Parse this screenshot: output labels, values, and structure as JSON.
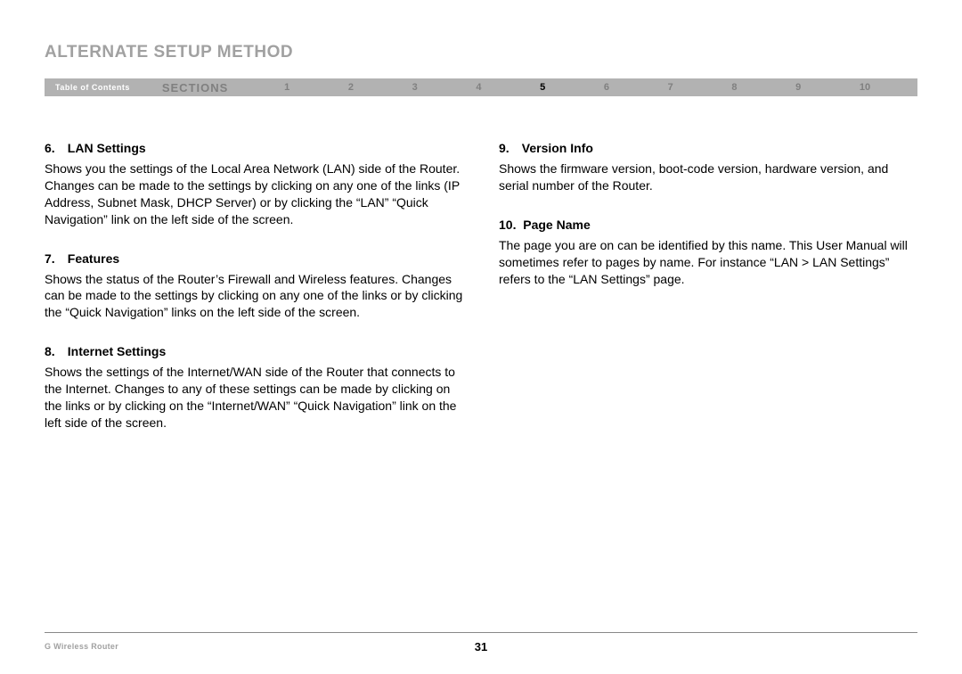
{
  "title": "ALTERNATE SETUP METHOD",
  "nav": {
    "toc": "Table of Contents",
    "sections_label": "SECTIONS",
    "sections": [
      "1",
      "2",
      "3",
      "4",
      "5",
      "6",
      "7",
      "8",
      "9",
      "10"
    ],
    "active_index": 4
  },
  "left_items": [
    {
      "num": "6.",
      "title": "LAN Settings",
      "body": "Shows you the settings of the Local Area Network (LAN) side of the Router. Changes can be made to the settings by clicking on any one of the links (IP Address, Subnet Mask, DHCP Server) or by clicking the “LAN” “Quick Navigation” link on the left side of the screen."
    },
    {
      "num": "7.",
      "title": "Features",
      "body": "Shows the status of the Router’s Firewall and Wireless features. Changes can be made to the settings by clicking on any one of the links or by clicking the “Quick Navigation” links on the left side of the screen."
    },
    {
      "num": "8.",
      "title": "Internet Settings",
      "body": "Shows the settings of the Internet/WAN side of the Router that connects to the Internet. Changes to any of these settings can be made by clicking on the links or by clicking on the “Internet/WAN” “Quick Navigation” link on the left side of the screen."
    }
  ],
  "right_items": [
    {
      "num": "9.",
      "title": "Version Info",
      "body": "Shows the firmware version, boot-code version, hardware version, and serial number of the Router."
    },
    {
      "num": "10.",
      "title": "Page Name",
      "body": "The page you are on can be identified by this name. This User Manual will sometimes refer to pages by name. For instance “LAN > LAN Settings” refers to the “LAN Settings” page."
    }
  ],
  "footer": {
    "product": "G Wireless Router",
    "page_number": "31"
  }
}
